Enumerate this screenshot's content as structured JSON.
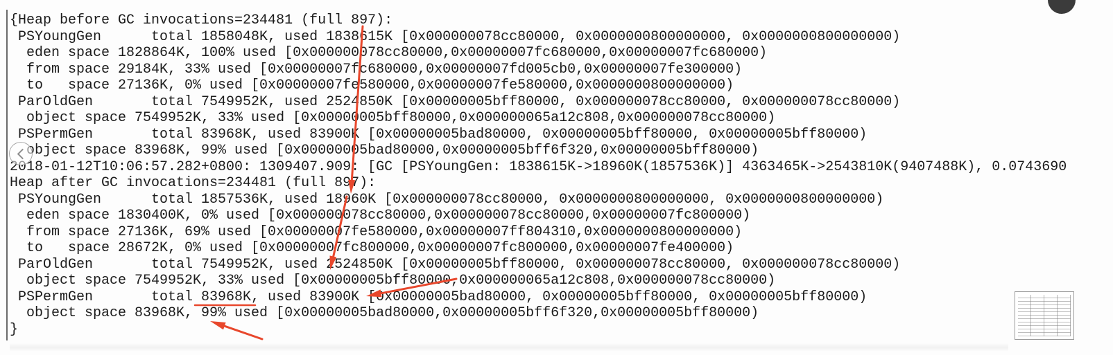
{
  "terminal": {
    "lines": [
      "{Heap before GC invocations=234481 (full 897):",
      " PSYoungGen      total 1858048K, used 1838615K [0x000000078cc80000, 0x0000000800000000, 0x0000000800000000)",
      "  eden space 1828864K, 100% used [0x000000078cc80000,0x00000007fc680000,0x00000007fc680000)",
      "  from space 29184K, 33% used [0x00000007fc680000,0x00000007fd005cb0,0x00000007fe300000)",
      "  to   space 27136K, 0% used [0x00000007fe580000,0x00000007fe580000,0x0000000800000000)",
      " ParOldGen       total 7549952K, used 2524850K [0x00000005bff80000, 0x000000078cc80000, 0x000000078cc80000)",
      "  object space 7549952K, 33% used [0x00000005bff80000,0x000000065a12c808,0x000000078cc80000)",
      " PSPermGen       total 83968K, used 83900K [0x00000005bad80000, 0x00000005bff80000, 0x00000005bff80000)",
      "  object space 83968K, 99% used [0x00000005bad80000,0x00000005bff6f320,0x00000005bff80000)",
      "2018-01-12T10:06:57.282+0800: 1309407.909: [GC [PSYoungGen: 1838615K->18960K(1857536K)] 4363465K->2543810K(9407488K), 0.0743690",
      "Heap after GC invocations=234481 (full 897):",
      " PSYoungGen      total 1857536K, used 18960K [0x000000078cc80000, 0x0000000800000000, 0x0000000800000000)",
      "  eden space 1830400K, 0% used [0x000000078cc80000,0x000000078cc80000,0x00000007fc800000)",
      "  from space 27136K, 69% used [0x00000007fe580000,0x00000007ff804310,0x0000000800000000)",
      "  to   space 28672K, 0% used [0x00000007fc800000,0x00000007fc800000,0x00000007fe400000)",
      " ParOldGen       total 7549952K, used 2524850K [0x00000005bff80000, 0x000000078cc80000, 0x000000078cc80000)",
      "  object space 7549952K, 33% used [0x00000005bff80000,0x000000065a12c808,0x000000078cc80000)",
      " PSPermGen       total 83968K, used 83900K [0x00000005bad80000, 0x00000005bff80000, 0x00000005bff80000)",
      "  object space 83968K, 99% used [0x00000005bad80000,0x00000005bff6f320,0x00000005bff80000)",
      "}"
    ]
  },
  "colors": {
    "annotation": "#e8472c",
    "text": "#1c1c1c",
    "background": "#fdfdfd"
  },
  "icons": {
    "prev_button": "chevron-left-icon",
    "top_right_button": "circle-button-icon",
    "thumbnail": "thumbnail-icon"
  }
}
